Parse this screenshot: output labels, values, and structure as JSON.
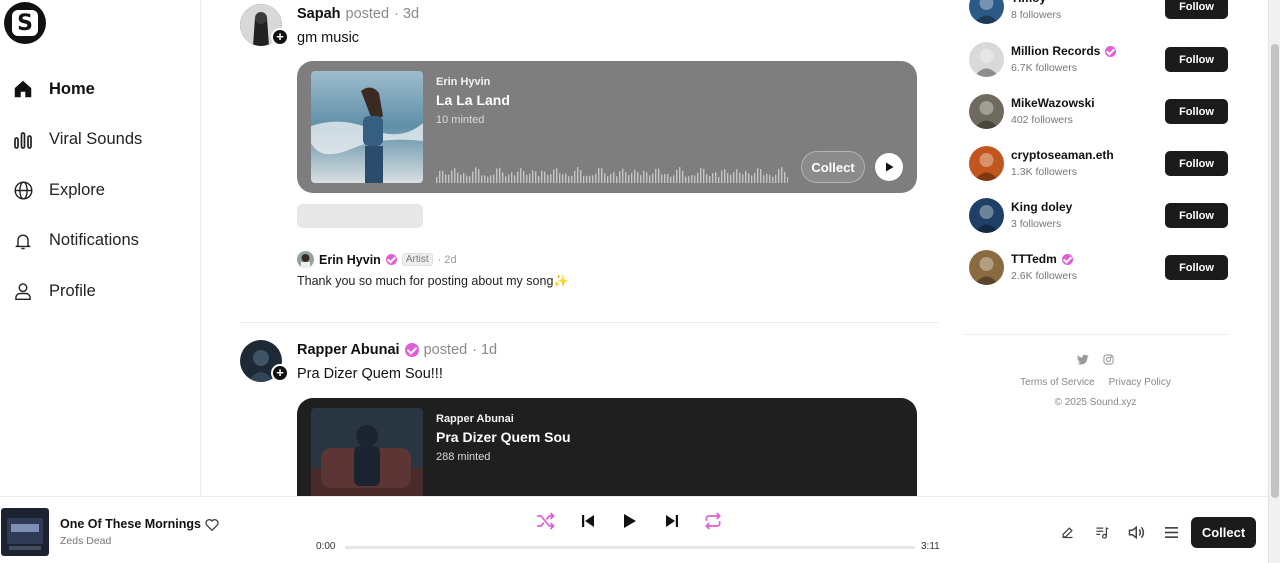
{
  "sidebar": {
    "logo": "S",
    "items": [
      {
        "label": "Home",
        "icon": "home-icon",
        "active": true
      },
      {
        "label": "Viral Sounds",
        "icon": "bars-icon"
      },
      {
        "label": "Explore",
        "icon": "globe-icon"
      },
      {
        "label": "Notifications",
        "icon": "bell-icon"
      },
      {
        "label": "Profile",
        "icon": "user-icon"
      }
    ]
  },
  "feed": {
    "posts": [
      {
        "user": "Sapah",
        "action": "posted",
        "age": "· 3d",
        "text": "gm music",
        "card": {
          "artist": "Erin Hyvin",
          "title": "La La Land",
          "minted": "10 minted",
          "collect": "Collect",
          "bg": "#7e7e7e"
        },
        "comment": {
          "user": "Erin Hyvin",
          "badge": "Artist",
          "age": "· 2d",
          "text": "Thank you so much for posting about my song✨"
        }
      },
      {
        "user": "Rapper Abunai",
        "action": "posted",
        "age": "· 1d",
        "text": "Pra Dizer Quem Sou!!!",
        "card": {
          "artist": "Rapper Abunai",
          "title": "Pra Dizer Quem Sou",
          "minted": "288 minted",
          "bg": "#1f1f1f"
        }
      }
    ]
  },
  "suggestions": {
    "follow_label": "Follow",
    "items": [
      {
        "name": "Timoy",
        "followers": "8 followers",
        "verified": false
      },
      {
        "name": "Million Records",
        "followers": "6.7K followers",
        "verified": true
      },
      {
        "name": "MikeWazowski",
        "followers": "402 followers",
        "verified": false
      },
      {
        "name": "cryptoseaman.eth",
        "followers": "1.3K followers",
        "verified": false
      },
      {
        "name": "King doley",
        "followers": "3 followers",
        "verified": false
      },
      {
        "name": "TTTedm",
        "followers": "2.6K followers",
        "verified": true
      }
    ]
  },
  "footer": {
    "terms": "Terms of Service",
    "privacy": "Privacy Policy",
    "copyright": "© 2025 Sound.xyz"
  },
  "player": {
    "title": "One Of These Mornings",
    "artist": "Zeds Dead",
    "elapsed": "0:00",
    "duration": "3:11",
    "progress": 0,
    "collect": "Collect",
    "accent": "#e05ed6"
  }
}
